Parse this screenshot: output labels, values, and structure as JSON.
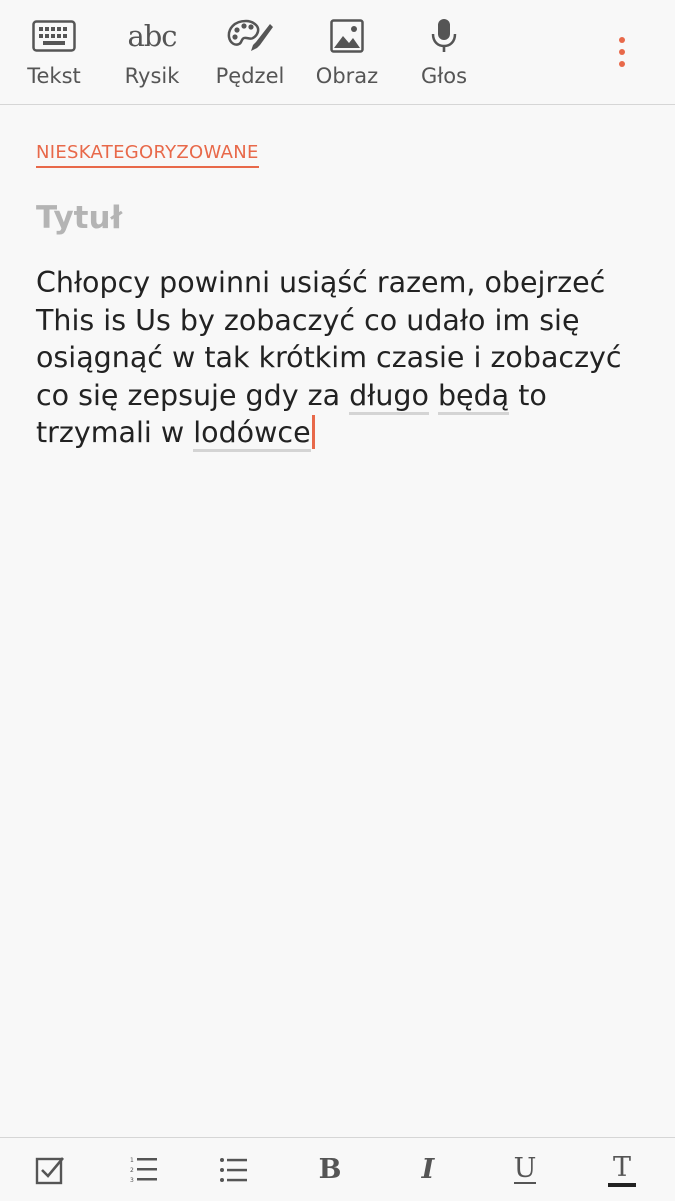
{
  "toolbar": {
    "items": [
      {
        "label": "Tekst",
        "icon": "keyboard-icon"
      },
      {
        "label": "Rysik",
        "icon": "abc-handwriting-icon",
        "glyph": "abc"
      },
      {
        "label": "Pędzel",
        "icon": "palette-brush-icon"
      },
      {
        "label": "Obraz",
        "icon": "image-icon"
      },
      {
        "label": "Głos",
        "icon": "microphone-icon"
      }
    ],
    "more_icon": "more-vertical-icon"
  },
  "note": {
    "category": "NIESKATEGORYZOWANE",
    "title_placeholder": "Tytuł",
    "body": {
      "line1": "Chłopcy powinni usiąść razem, obejrzeć",
      "line2": "This is Us by zobaczyć co udało im się",
      "line3": "osiągnąć w tak krótkim czasie i zobaczyć",
      "line4a": "co się zepsuje gdy za ",
      "w_dlugo": "długo",
      "sp": " ",
      "w_beda": "będą",
      "line4b": " to",
      "line5a": "trzymali w ",
      "w_lodowce": "lodówce"
    }
  },
  "format_bar": {
    "checkbox_icon": "checkbox-icon",
    "numbered_list_icon": "numbered-list-icon",
    "bullet_list_icon": "bullet-list-icon",
    "bold_label": "B",
    "italic_label": "I",
    "underline_label": "U",
    "text_color_label": "T"
  },
  "colors": {
    "accent": "#e8694a",
    "background": "#f8f8f8",
    "icon_gray": "#555555"
  }
}
